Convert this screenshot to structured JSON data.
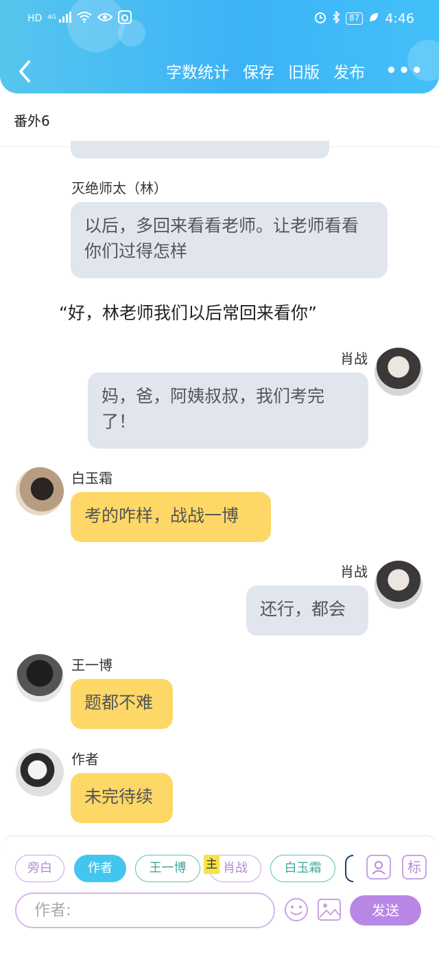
{
  "status_bar": {
    "left_icons": [
      "hd-icon",
      "signal-4g-icon",
      "wifi-icon",
      "eye-icon",
      "app-icon"
    ],
    "hd": "HD",
    "net": "4G",
    "battery": "87",
    "time": "4:46"
  },
  "nav": {
    "actions": [
      "字数统计",
      "保存",
      "旧版",
      "发布"
    ],
    "more": "•••"
  },
  "chapter_title": "番外6",
  "messages": [
    {
      "speaker": "灭绝师太（林）",
      "text": "以后，多回来看看老师。让老师看看你们过得怎样",
      "side": "left",
      "style": "grey"
    },
    {
      "narration": "“好，林老师我们以后常回来看你”"
    },
    {
      "speaker": "肖战",
      "text": "妈，爸，阿姨叔叔，我们考完了！",
      "side": "right",
      "style": "grey"
    },
    {
      "speaker": "白玉霜",
      "text": "考的咋样，战战一博",
      "side": "left",
      "style": "yellow"
    },
    {
      "speaker": "肖战",
      "text": "还行，都会",
      "side": "right",
      "style": "grey"
    },
    {
      "speaker": "王一博",
      "text": "题都不难",
      "side": "left",
      "style": "yellow"
    },
    {
      "speaker": "作者",
      "text": "未完待续",
      "side": "left",
      "style": "yellow"
    }
  ],
  "toolbar": {
    "chips": [
      "旁白",
      "作者",
      "王一博",
      "肖战",
      "白玉霜"
    ],
    "active_chip": "作者",
    "main_tag": "主",
    "icon_role": "标",
    "input_placeholder": "作者:",
    "send": "发送"
  },
  "colors": {
    "header": "#3db3f7",
    "grey_bubble": "#e1e6ee",
    "yellow_bubble": "#fdd866",
    "accent_purple": "#b887e6",
    "chip_teal": "#42a89e"
  }
}
